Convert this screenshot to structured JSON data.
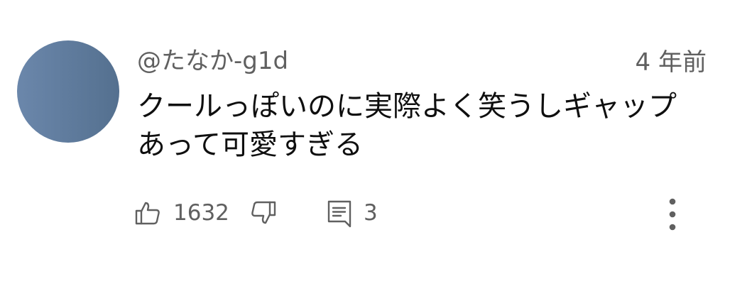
{
  "comment": {
    "author": "@たなか-g1d",
    "timestamp": "4 年前",
    "text_lines": [
      "クールっぽいのに実際よく笑うしギャップ",
      "あって可愛すぎる"
    ],
    "avatar_color": "#5f7b9e"
  },
  "actions": {
    "like_icon": "thumbs-up-icon",
    "like_count": "1632",
    "dislike_icon": "thumbs-down-icon",
    "reply_icon": "comment-icon",
    "reply_count": "3",
    "more_icon": "more-vertical-icon"
  }
}
